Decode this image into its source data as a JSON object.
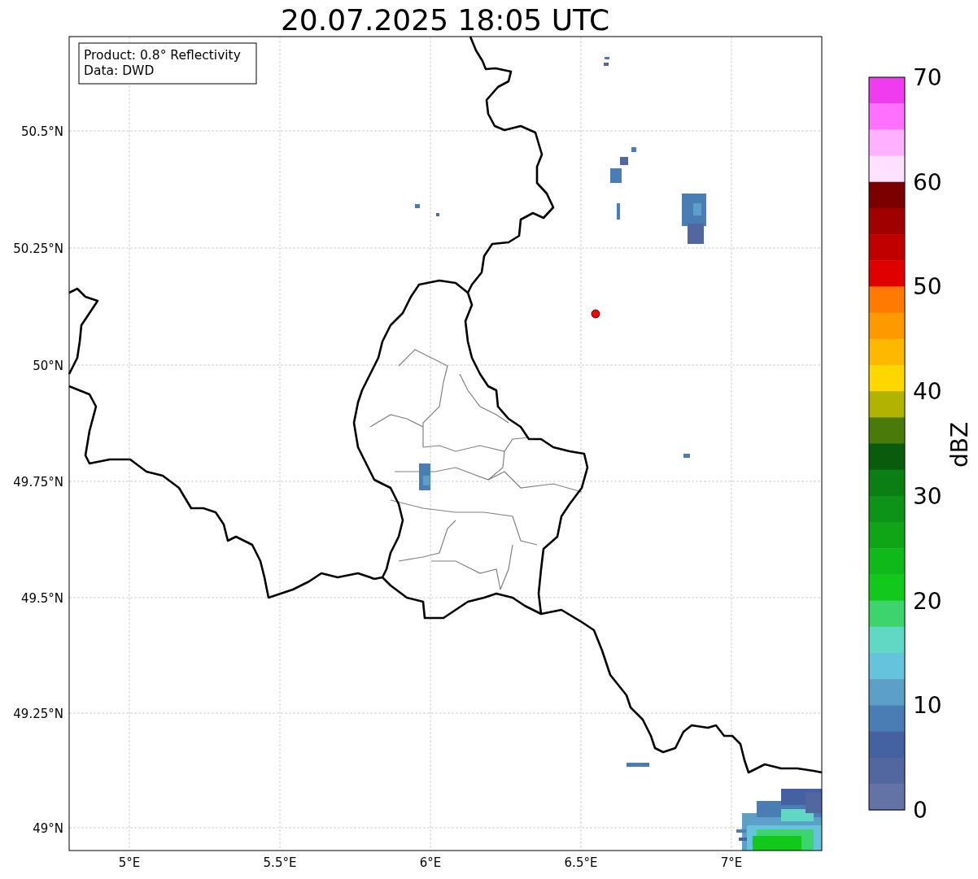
{
  "title": "20.07.2025 18:05 UTC",
  "info_box": [
    "Product: 0.8° Reflectivity",
    "Data: DWD"
  ],
  "x_ticks": [
    "5°E",
    "5.5°E",
    "6°E",
    "6.5°E",
    "7°E"
  ],
  "y_ticks": [
    "50.5°N",
    "50.25°N",
    "50°N",
    "49.75°N",
    "49.5°N",
    "49.25°N",
    "49°N"
  ],
  "colorbar": {
    "label": "dBZ",
    "ticks": [
      "70",
      "60",
      "50",
      "40",
      "30",
      "20",
      "10",
      "0"
    ],
    "bins": [
      {
        "color": "#ee3cee"
      },
      {
        "color": "#ff70ff"
      },
      {
        "color": "#ffb0ff"
      },
      {
        "color": "#ffe0ff"
      },
      {
        "color": "#7a0000"
      },
      {
        "color": "#a00000"
      },
      {
        "color": "#c00000"
      },
      {
        "color": "#e00000"
      },
      {
        "color": "#ff7a00"
      },
      {
        "color": "#ff9900"
      },
      {
        "color": "#ffb800"
      },
      {
        "color": "#ffd700"
      },
      {
        "color": "#b1b300"
      },
      {
        "color": "#4a7a0a"
      },
      {
        "color": "#085c0b"
      },
      {
        "color": "#0b7f14"
      },
      {
        "color": "#0d9317"
      },
      {
        "color": "#0fa516"
      },
      {
        "color": "#10b91a"
      },
      {
        "color": "#12c81b"
      },
      {
        "color": "#3dd46e"
      },
      {
        "color": "#60d8c3"
      },
      {
        "color": "#66c3dc"
      },
      {
        "color": "#5c9fc7"
      },
      {
        "color": "#4b7db5"
      },
      {
        "color": "#4461a2"
      },
      {
        "color": "#5266a0"
      },
      {
        "color": "#6473a6"
      }
    ]
  }
}
